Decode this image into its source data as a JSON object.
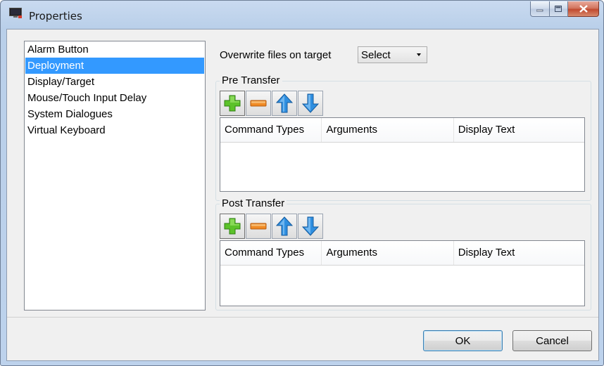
{
  "window": {
    "title": "Properties"
  },
  "categories": [
    {
      "label": "Alarm Button",
      "selected": false
    },
    {
      "label": "Deployment",
      "selected": true
    },
    {
      "label": "Display/Target",
      "selected": false
    },
    {
      "label": "Mouse/Touch Input Delay",
      "selected": false
    },
    {
      "label": "System Dialogues",
      "selected": false
    },
    {
      "label": "Virtual Keyboard",
      "selected": false
    }
  ],
  "overwrite": {
    "label": "Overwrite files on target",
    "value": "Select"
  },
  "pre_transfer": {
    "label": "Pre Transfer",
    "columns": [
      "Command Types",
      "Arguments",
      "Display Text"
    ]
  },
  "post_transfer": {
    "label": "Post Transfer",
    "columns": [
      "Command Types",
      "Arguments",
      "Display Text"
    ]
  },
  "buttons": {
    "ok": "OK",
    "cancel": "Cancel"
  },
  "colors": {
    "selection": "#3399ff",
    "add_icon": "#5cc22a",
    "remove_icon": "#f08a24",
    "arrow_icon": "#2f8fe0"
  }
}
